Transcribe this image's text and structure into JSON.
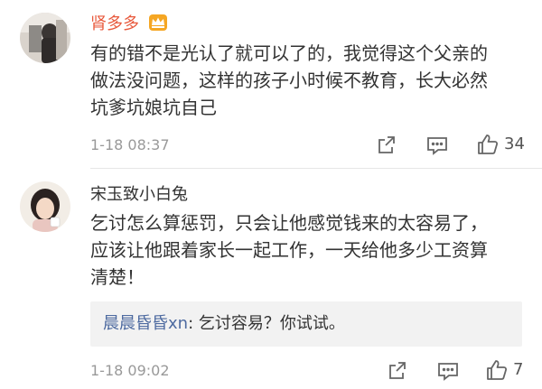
{
  "comments": [
    {
      "username": "肾多多",
      "badge_icon": "vip-crown-icon",
      "text_lines": [
        "有的错不是光认了就可以了的，我觉得这个父亲的",
        "做法没问题，这样的孩子小时候不教育，长大必然",
        "坑爹坑娘坑自己"
      ],
      "timestamp": "1-18 08:37",
      "like_count": "34",
      "name_color": "#e8593c"
    },
    {
      "username": "宋玉致小白兔",
      "text_lines": [
        "乞讨怎么算惩罚，只会让他感觉钱来的太容易了，",
        "应该让他跟着家长一起工作，一天给他多少工资算",
        "清楚！"
      ],
      "reply": {
        "user": "晨晨昏昏xn",
        "separator": ": ",
        "text": "乞讨容易？你试试。"
      },
      "timestamp": "1-18 09:02",
      "like_count": "7",
      "name_color": "#333333"
    }
  ],
  "icons": {
    "share": "share-icon",
    "comment": "comment-icon",
    "like": "like-icon"
  }
}
